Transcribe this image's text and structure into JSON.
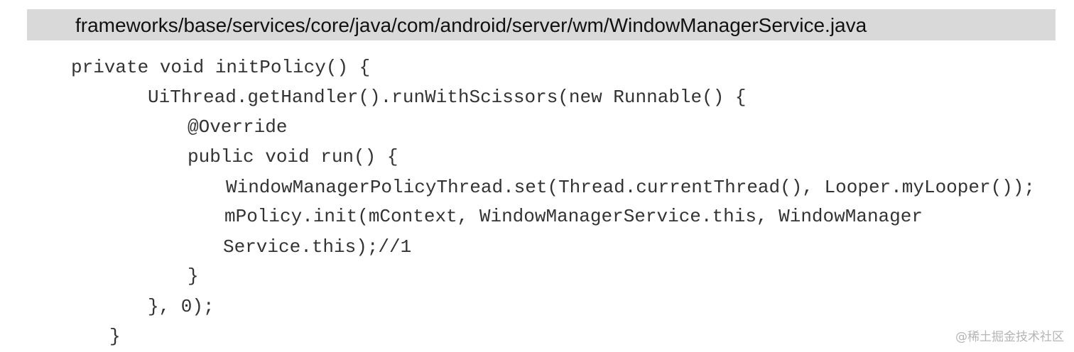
{
  "header": {
    "file_path": "frameworks/base/services/core/java/com/android/server/wm/WindowManagerService.java"
  },
  "code": {
    "lines": [
      "private void initPolicy() {",
      "UiThread.getHandler().runWithScissors(new Runnable() {",
      "@Override",
      "public void run() {",
      "WindowManagerPolicyThread.set(Thread.currentThread(), Looper.myLooper());",
      "mPolicy.init(mContext, WindowManagerService.this, WindowManager",
      "Service.this);//1",
      "}",
      "}, 0);",
      "}"
    ]
  },
  "watermark": {
    "text": "@稀土掘金技术社区"
  }
}
